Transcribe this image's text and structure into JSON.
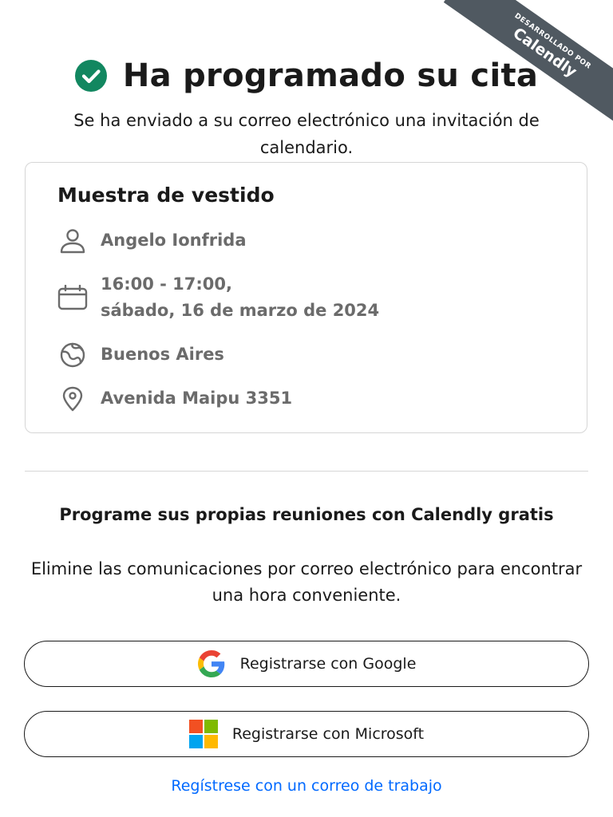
{
  "ribbon": {
    "small_text": "DESARROLLADO POR",
    "brand": "Calendly"
  },
  "header": {
    "title": "Ha programado su cita",
    "subtitle": "Se ha enviado a su correo electrónico una invitación de calendario.",
    "check_color": "#128760"
  },
  "event": {
    "title": "Muestra de vestido",
    "host": "Angelo Ionfrida",
    "time": "16:00 - 17:00,",
    "date": "sábado, 16 de marzo de 2024",
    "timezone": "Buenos Aires",
    "location": "Avenida Maipu 3351"
  },
  "promo": {
    "title": "Programe sus propias reuniones con Calendly gratis",
    "text": "Elimine las comunicaciones por correo electrónico para encontrar una hora conveniente."
  },
  "actions": {
    "google_label": "Registrarse con Google",
    "microsoft_label": "Registrarse con Microsoft",
    "work_email_link": "Regístrese con un correo de trabajo",
    "link_color": "#0069ff"
  },
  "icons": {
    "check": "check-circle-icon",
    "host": "person-icon",
    "time": "calendar-icon",
    "timezone": "globe-icon",
    "location": "location-pin-icon",
    "google": "google-logo-icon",
    "microsoft": "microsoft-logo-icon"
  }
}
